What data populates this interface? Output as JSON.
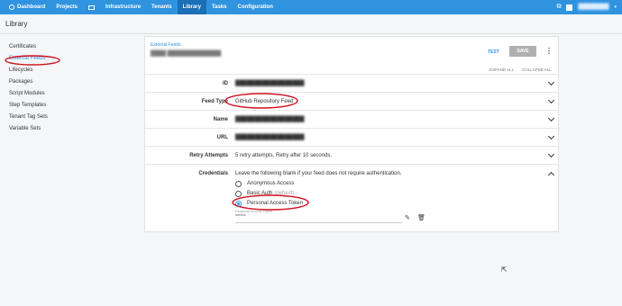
{
  "nav": {
    "items": [
      {
        "label": "Dashboard",
        "icon": "octopus-icon"
      },
      {
        "label": "Projects"
      },
      {
        "label": ""
      },
      {
        "label": "Infrastructure"
      },
      {
        "label": "Tenants"
      },
      {
        "label": "Library"
      },
      {
        "label": "Tasks"
      },
      {
        "label": "Configuration"
      }
    ],
    "user": "████████"
  },
  "page": {
    "title": "Library"
  },
  "sidebar": {
    "items": [
      {
        "label": "Certificates"
      },
      {
        "label": "External Feeds"
      },
      {
        "label": "Lifecycles"
      },
      {
        "label": "Packages"
      },
      {
        "label": "Script Modules"
      },
      {
        "label": "Step Templates"
      },
      {
        "label": "Tenant Tag Sets"
      },
      {
        "label": "Variable Sets"
      }
    ]
  },
  "card": {
    "breadcrumb": "External Feeds",
    "feed_name": "████ ██████████████",
    "test_label": "TEST",
    "save_label": "SAVE",
    "expand_all": "EXPAND ALL",
    "collapse_all": "COLLAPSE ALL"
  },
  "fields": {
    "id": {
      "label": "ID",
      "value": "██████████████████"
    },
    "feed_type": {
      "label": "Feed Type",
      "value": "GitHub Repository Feed"
    },
    "name": {
      "label": "Name",
      "value": "██████████████████"
    },
    "url": {
      "label": "URL",
      "value": "██████████████████"
    },
    "retry": {
      "label": "Retry Attempts",
      "value": "5 retry attempts. Retry after 10 seconds."
    },
    "credentials": {
      "label": "Credentials",
      "hint": "Leave the following blank if your feed does not require authentication.",
      "options": [
        {
          "label": "Anonymous Access",
          "suffix": ""
        },
        {
          "label": "Basic Auth",
          "suffix": "(default)"
        },
        {
          "label": "Personal Access Token",
          "suffix": ""
        }
      ],
      "selected": "Personal Access Token",
      "token_label": "Personal Access Token",
      "token_value": "******"
    }
  },
  "colors": {
    "accent": "#2f93e0",
    "annotation": "#d01020"
  }
}
